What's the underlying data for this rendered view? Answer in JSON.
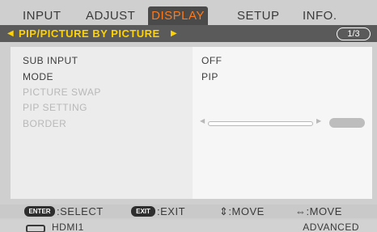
{
  "tabs": [
    {
      "label": "INPUT"
    },
    {
      "label": "ADJUST"
    },
    {
      "label": "DISPLAY"
    },
    {
      "label": "SETUP"
    },
    {
      "label": "INFO."
    }
  ],
  "active_tab": "DISPLAY",
  "submenu": {
    "title": "PIP/PICTURE BY PICTURE",
    "page_indicator": "1/3"
  },
  "menu_items": [
    {
      "label": "SUB INPUT",
      "value": "OFF",
      "enabled": true
    },
    {
      "label": "MODE",
      "value": "PIP",
      "enabled": true
    },
    {
      "label": "PICTURE SWAP",
      "enabled": false
    },
    {
      "label": "PIP SETTING",
      "enabled": false
    },
    {
      "label": "BORDER",
      "enabled": false
    }
  ],
  "guide": [
    {
      "key": "ENTER",
      "label": ":SELECT"
    },
    {
      "key": "EXIT",
      "label": ":EXIT"
    },
    {
      "key": "",
      "label": "⇕:MOVE"
    },
    {
      "key": "",
      "label": "⇔:MOVE"
    }
  ],
  "status": {
    "source": "HDMI1",
    "mode": "ADVANCED"
  },
  "colors": {
    "highlight": "#ff7a1a",
    "title": "#ffd200",
    "titlebar_bg": "#5a5a5a"
  }
}
